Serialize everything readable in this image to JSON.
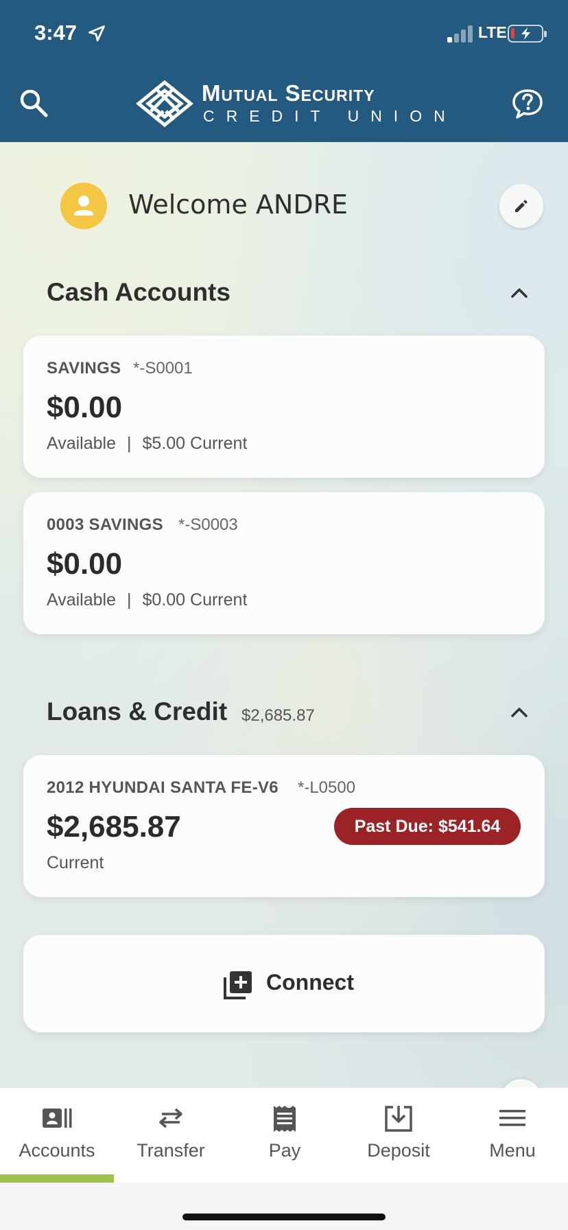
{
  "status_bar": {
    "time": "3:47",
    "network": "LTE"
  },
  "header": {
    "brand_title": "Mutual Security",
    "brand_subtitle": "CREDIT UNION",
    "colors": {
      "bar": "#255a80",
      "text": "#ffffff"
    }
  },
  "welcome": {
    "text": "Welcome ANDRE"
  },
  "cash_accounts": {
    "title": "Cash Accounts",
    "accounts": [
      {
        "name": "SAVINGS",
        "number": "*-S0001",
        "balance": "$0.00",
        "available_label": "Available",
        "separator": "|",
        "current": "$5.00 Current"
      },
      {
        "name": "0003 SAVINGS",
        "number": "*-S0003",
        "balance": "$0.00",
        "available_label": "Available",
        "separator": "|",
        "current": "$0.00 Current"
      }
    ]
  },
  "loans": {
    "title": "Loans & Credit",
    "total": "$2,685.87",
    "accounts": [
      {
        "name": "2012 HYUNDAI SANTA FE-V6",
        "number": "*-L0500",
        "balance": "$2,685.87",
        "status_label": "Current",
        "past_due": "Past Due: $541.64"
      }
    ]
  },
  "connect": {
    "label": "Connect"
  },
  "bottom_nav": {
    "items": [
      {
        "label": "Accounts",
        "icon": "accounts-icon",
        "selected": true
      },
      {
        "label": "Transfer",
        "icon": "transfer-icon"
      },
      {
        "label": "Pay",
        "icon": "pay-icon"
      },
      {
        "label": "Deposit",
        "icon": "deposit-icon"
      },
      {
        "label": "Menu",
        "icon": "menu-icon"
      }
    ],
    "accent": "#9cc24c"
  },
  "colors": {
    "avatar": "#f3c744",
    "past_due": "#9b2226"
  }
}
